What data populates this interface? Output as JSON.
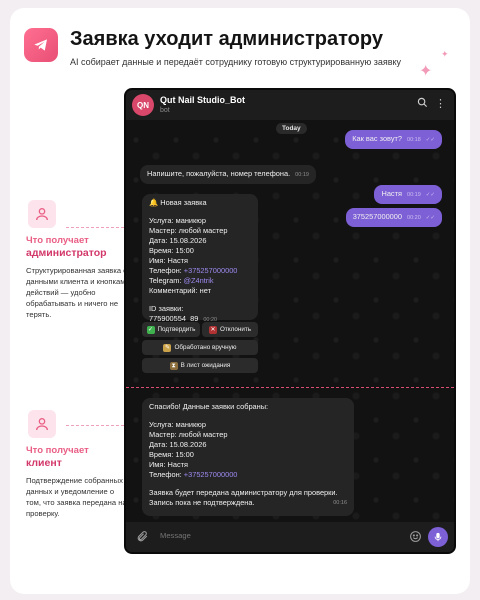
{
  "header": {
    "title": "Заявка уходит администратору",
    "subtitle": "AI собирает данные и передаёт сотруднику готовую структурированную заявку"
  },
  "admin_panel": {
    "label_prefix": "Что получает",
    "label_role": "администратор",
    "description": "Структурированная заявка с данными клиента и кнопками действий — удобно обрабатывать и ничего не терять."
  },
  "client_panel": {
    "label_prefix": "Что получает",
    "label_role": "клиент",
    "description": "Подтверждение собранных данных и уведомление о том, что заявка передана на проверку."
  },
  "chat": {
    "avatar_initials": "QN",
    "bot_name": "Qut Nail Studio_Bot",
    "bot_status": "bot",
    "day_label": "Today",
    "messages": [
      {
        "text": "Как вас зовут?",
        "time": "00:18"
      },
      {
        "text": "Напишите, пожалуйста, номер телефона.",
        "time": "00:19"
      },
      {
        "text": "Настя",
        "time": "00:19"
      },
      {
        "text": "375257000000",
        "time": "00:20"
      }
    ],
    "admin_card": {
      "title": "Новая заявка",
      "service": "Услуга: маникюр",
      "master": "Мастер: любой мастер",
      "date": "Дата: 15.08.2026",
      "time": "Время: 15:00",
      "name": "Имя: Настя",
      "phone_label": "Телефон:",
      "phone": "+375257000000",
      "telegram_label": "Telegram:",
      "telegram": "@Z4ntrik",
      "comment": "Комментарий: нет",
      "request_id": "ID заявки: 775900554_89",
      "ts": "00:20"
    },
    "buttons": {
      "confirm": "Подтвердить",
      "reject": "Отклонить",
      "manual": "Обработано вручную",
      "waitlist": "В лист ожидания"
    },
    "client_card": {
      "intro": "Спасибо! Данные заявки собраны:",
      "service": "Услуга: маникюр",
      "master": "Мастер: любой мастер",
      "date": "Дата: 15.08.2026",
      "time": "Время: 15:00",
      "name": "Имя: Настя",
      "phone_label": "Телефон:",
      "phone": "+375257000000",
      "note1": "Заявка будет передана администратору для проверки.",
      "note2": "Запись пока не подтверждена.",
      "ts": "00:16"
    },
    "composer_placeholder": "Message"
  },
  "colors": {
    "accent": "#ea5e85",
    "bubble_out": "#7d5fd6",
    "bubble_in": "#252525",
    "chat_bg": "#121212"
  }
}
